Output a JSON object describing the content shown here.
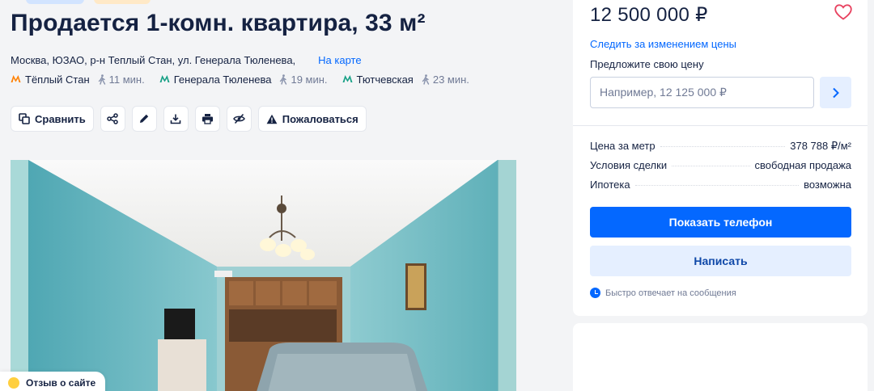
{
  "listing": {
    "title": "Продается 1-комн. квартира, 33 м²",
    "address": "Москва, ЮЗАО, р-н Теплый Стан, ул. Генерала Тюленева,",
    "map_link": "На карте",
    "metro": [
      {
        "name": "Тёплый Стан",
        "walk": "11 мин."
      },
      {
        "name": "Генерала Тюленева",
        "walk": "19 мин."
      },
      {
        "name": "Тютчевская",
        "walk": "23 мин."
      }
    ],
    "metro_color": "#ff8103",
    "metro_color_2": "#16a085"
  },
  "actions": {
    "compare": "Сравнить",
    "complain": "Пожаловаться"
  },
  "feedback": {
    "label": "Отзыв о сайте"
  },
  "sidebar": {
    "price": "12 500 000 ₽",
    "follow_price": "Следить за изменением цены",
    "offer_label": "Предложите свою цену",
    "offer_placeholder": "Например, 12 125 000 ₽",
    "specs": [
      {
        "key": "Цена за метр",
        "value": "378 788 ₽/м²"
      },
      {
        "key": "Условия сделки",
        "value": "свободная продажа"
      },
      {
        "key": "Ипотека",
        "value": "возможна"
      }
    ],
    "show_phone": "Показать телефон",
    "write": "Написать",
    "quick_reply": "Быстро отвечает на сообщения"
  },
  "colors": {
    "accent": "#0468ff",
    "accent_light": "#e5efff"
  }
}
